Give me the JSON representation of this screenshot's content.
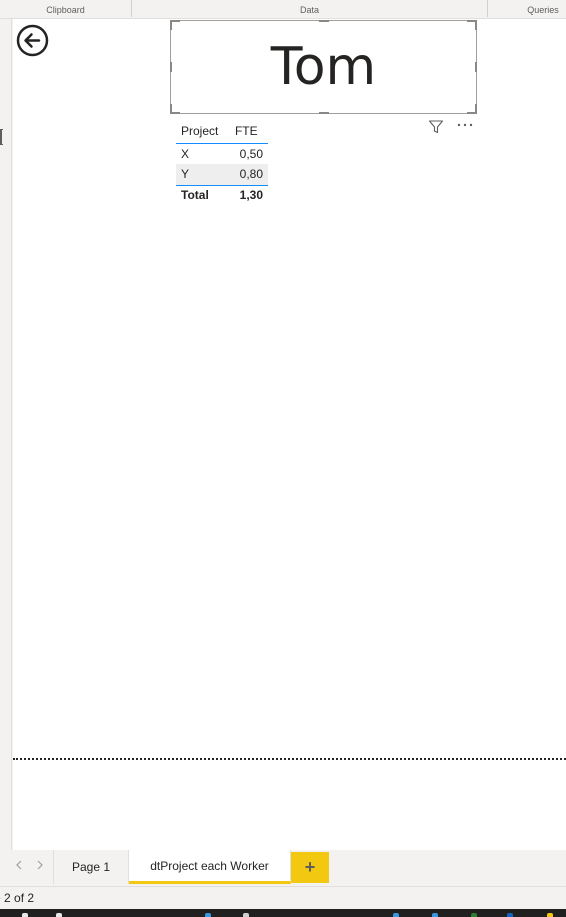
{
  "ribbon": {
    "groups": {
      "clipboard": "Clipboard",
      "data": "Data",
      "queries": "Queries"
    }
  },
  "canvas": {
    "back_button_icon": "back-arrow-circle-icon",
    "card": {
      "value": "Tom"
    },
    "visual_header": {
      "filter_icon": "filter-icon",
      "more_options_icon": "more-options-icon"
    },
    "table": {
      "columns": [
        "Project",
        "FTE"
      ],
      "rows": [
        [
          "X",
          "0,50"
        ],
        [
          "Y",
          "0,80"
        ]
      ],
      "total": [
        "Total",
        "1,30"
      ]
    }
  },
  "page_tabs": {
    "tabs": [
      {
        "label": "Page 1",
        "active": false
      },
      {
        "label": "dtProject each Worker",
        "active": true
      }
    ],
    "add_icon": "plus-icon",
    "prev_icon": "chevron-left-icon",
    "next_icon": "chevron-right-icon"
  },
  "status": {
    "page_indicator": "e 2 of 2"
  },
  "colors": {
    "accent": "#f2c811",
    "table_rule": "#118dff",
    "canvas": "#ffffff",
    "chrome": "#f3f2f1"
  }
}
